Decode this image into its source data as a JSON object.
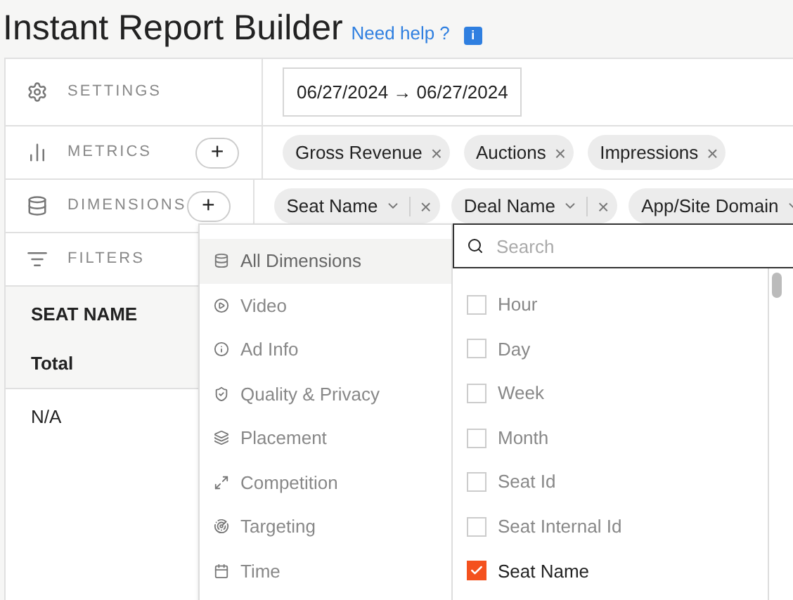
{
  "title": "Instant Report Builder",
  "help_link": "Need help ?",
  "info_badge": "i",
  "sections": [
    {
      "kind": "settings",
      "label": "SETTINGS",
      "date_range": "06/27/2024 → 06/27/2024"
    },
    {
      "kind": "metrics",
      "label": "METRICS",
      "add": "+",
      "chips": [
        "Gross Revenue",
        "Auctions",
        "Impressions"
      ],
      "remove": "×"
    },
    {
      "kind": "dimensions",
      "label": "DIMENSIONS",
      "add": "+",
      "chips": [
        "Seat Name",
        "Deal Name",
        "App/Site Domain"
      ],
      "remove": "×"
    },
    {
      "kind": "filters",
      "label": "FILTERS"
    }
  ],
  "table": {
    "column": "SEAT NAME",
    "total": "Total",
    "rows": [
      "N/A"
    ]
  },
  "dropdown": {
    "categories": [
      {
        "label": "All Dimensions",
        "selected": true
      },
      {
        "label": "Video",
        "selected": false
      },
      {
        "label": "Ad Info",
        "selected": false
      },
      {
        "label": "Quality & Privacy",
        "selected": false
      },
      {
        "label": "Placement",
        "selected": false
      },
      {
        "label": "Competition",
        "selected": false
      },
      {
        "label": "Targeting",
        "selected": false
      },
      {
        "label": "Time",
        "selected": false
      }
    ],
    "search": {
      "placeholder": "Search"
    },
    "options": [
      {
        "label": "Hour",
        "checked": false
      },
      {
        "label": "Day",
        "checked": false
      },
      {
        "label": "Week",
        "checked": false
      },
      {
        "label": "Month",
        "checked": false
      },
      {
        "label": "Seat Id",
        "checked": false
      },
      {
        "label": "Seat Internal Id",
        "checked": false
      },
      {
        "label": "Seat Name",
        "checked": true
      }
    ]
  }
}
